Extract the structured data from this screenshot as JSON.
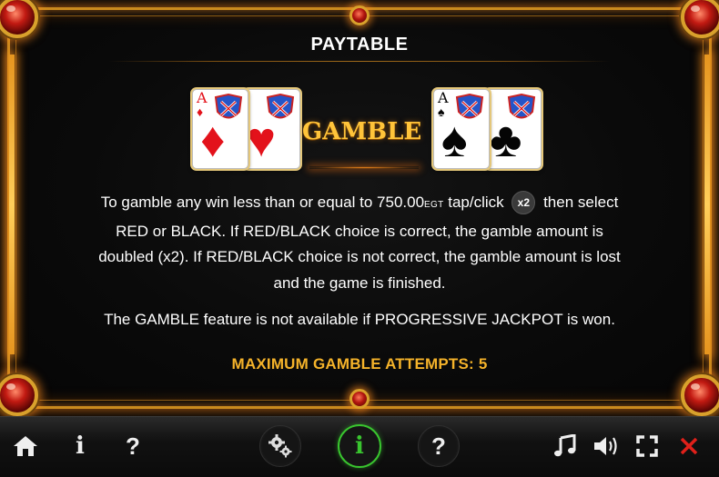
{
  "header": {
    "title": "PAYTABLE"
  },
  "gamble_banner": {
    "label": "GAMBLE",
    "red_cards": [
      {
        "rank": "A",
        "suit": "diamond-icon"
      },
      {
        "rank": "",
        "suit": "heart-icon"
      }
    ],
    "black_cards": [
      {
        "rank": "A",
        "suit": "spade-icon"
      },
      {
        "rank": "",
        "suit": "club-icon"
      }
    ]
  },
  "rules": {
    "line1_prefix": "To gamble any win less than or equal to ",
    "limit_amount": "750.00",
    "currency": "EGT",
    "line1_mid": " tap/click ",
    "x2_badge": "x2",
    "line1_suffix": " then select",
    "line2": "RED or BLACK. If RED/BLACK choice is correct, the gamble amount is",
    "line3": "doubled (x2). If RED/BLACK choice is not correct, the gamble amount is lost",
    "line4": "and the game is finished.",
    "jackpot_note": "The GAMBLE feature is not available if PROGRESSIVE JACKPOT is won.",
    "max_attempts": "MAXIMUM GAMBLE ATTEMPTS: 5"
  },
  "toolbar": {
    "left": [
      "home-icon",
      "info-icon",
      "help-icon"
    ],
    "center": [
      "settings-icon",
      "info-icon",
      "help-icon"
    ],
    "center_active": "info-icon",
    "right": [
      "music-icon",
      "sound-icon",
      "fullscreen-icon",
      "close-icon"
    ],
    "info_glyph": "i",
    "help_glyph": "?"
  },
  "colors": {
    "frame_gold": "#c98a1e",
    "gem_red": "#c21a12",
    "highlight_text": "#f5b32a",
    "gamble_title": "#ffc43a",
    "active_ring": "#39c52f",
    "close_red": "#e0201a"
  }
}
